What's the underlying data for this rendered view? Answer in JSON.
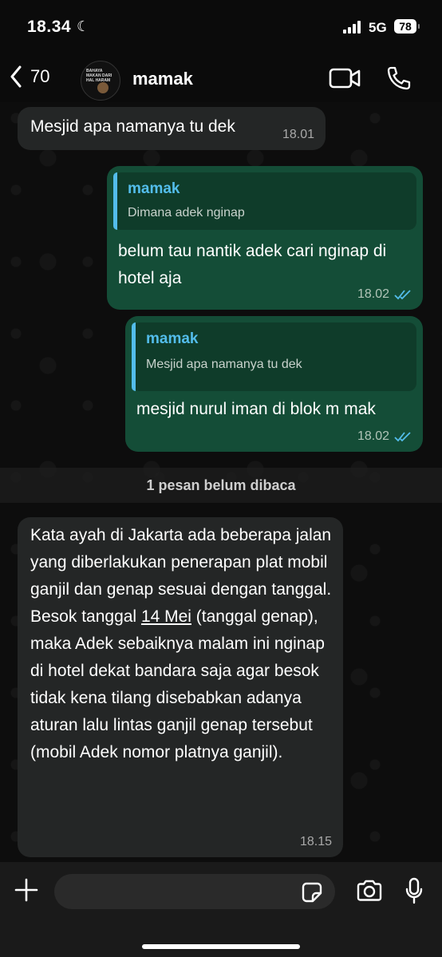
{
  "status_bar": {
    "time": "18.34",
    "network": "5G",
    "battery": "78"
  },
  "header": {
    "back_count": "70",
    "contact_name": "mamak",
    "avatar_caption": "BAHAYA MAKAN DARI HAL HARAM"
  },
  "messages": [
    {
      "direction": "in",
      "text": "Mesjid apa namanya tu dek",
      "time": "18.01"
    },
    {
      "direction": "out",
      "quote_author": "mamak",
      "quote_text": "Dimana adek nginap",
      "text": "belum tau nantik adek cari nginap di hotel aja",
      "time": "18.02",
      "read": true
    },
    {
      "direction": "out",
      "quote_author": "mamak",
      "quote_text": "Mesjid apa namanya tu dek",
      "text": "mesjid nurul iman di blok m mak",
      "time": "18.02",
      "read": true
    },
    {
      "direction": "in",
      "text_before_link": "Kata ayah di Jakarta ada beberapa jalan yang  diberlakukan penerapan plat mobil ganjil dan genap sesuai dengan tanggal. Besok tanggal ",
      "link_text": "14 Mei",
      "text_after_link": " (tanggal genap), maka Adek sebaiknya malam ini nginap di hotel dekat bandara saja agar besok tidak kena tilang disebabkan adanya aturan lalu lintas ganjil genap tersebut (mobil Adek nomor platnya ganjil).",
      "time": "18.15"
    }
  ],
  "unread_banner": "1 pesan belum dibaca",
  "input": {
    "placeholder": ""
  },
  "colors": {
    "outgoing_bubble": "#144d37",
    "incoming_bubble": "#242626",
    "accent": "#53bdeb"
  }
}
